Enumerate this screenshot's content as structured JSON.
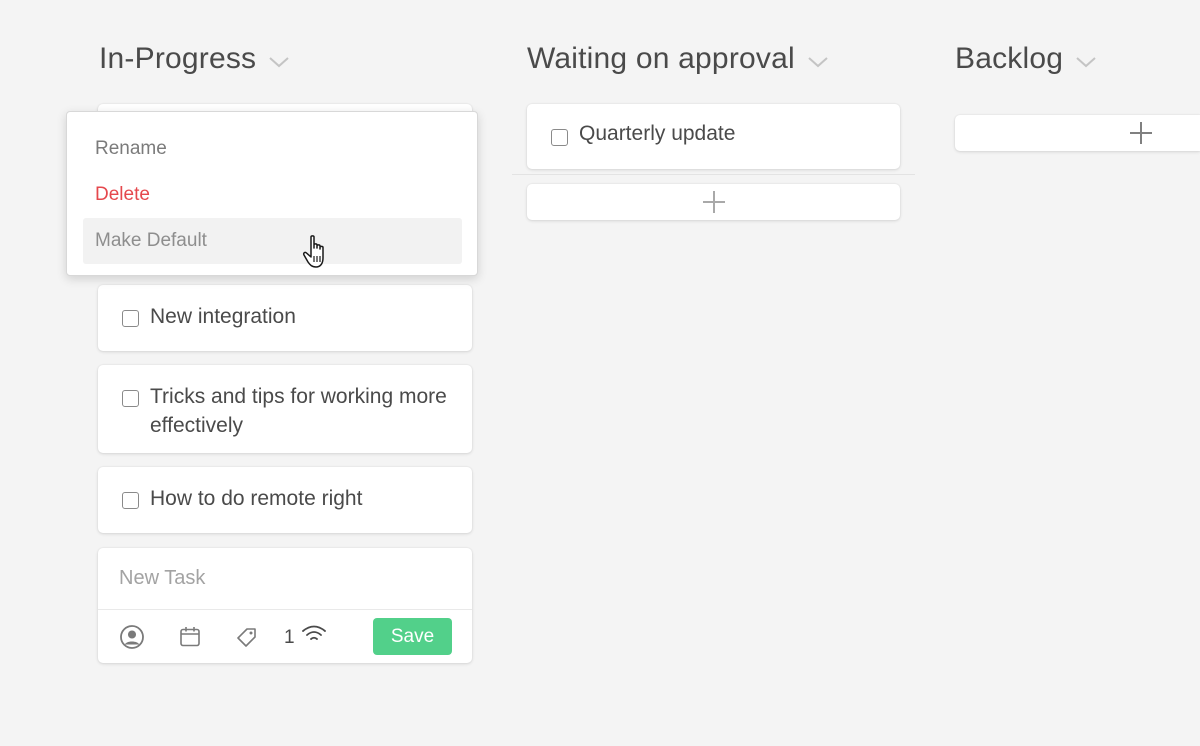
{
  "columns": [
    {
      "title": "In-Progress",
      "tasks": [
        "New integration",
        "Tricks and tips for working more effectively",
        "How to do remote right"
      ]
    },
    {
      "title": "Waiting on approval",
      "tasks": [
        "Quarterly update"
      ]
    },
    {
      "title": "Backlog",
      "tasks": []
    }
  ],
  "context_menu": {
    "rename": "Rename",
    "delete": "Delete",
    "make_default": "Make Default"
  },
  "new_task": {
    "placeholder": "New Task",
    "subscriber_count": "1",
    "save_label": "Save"
  },
  "colors": {
    "background": "#f4f4f4",
    "save_button": "#52d08a",
    "delete_text": "#e5484d"
  },
  "icons": [
    "chevron-down-icon",
    "checkbox-icon",
    "plus-icon",
    "user-icon",
    "calendar-icon",
    "tag-icon",
    "subscribers-icon",
    "hand-cursor-icon"
  ]
}
